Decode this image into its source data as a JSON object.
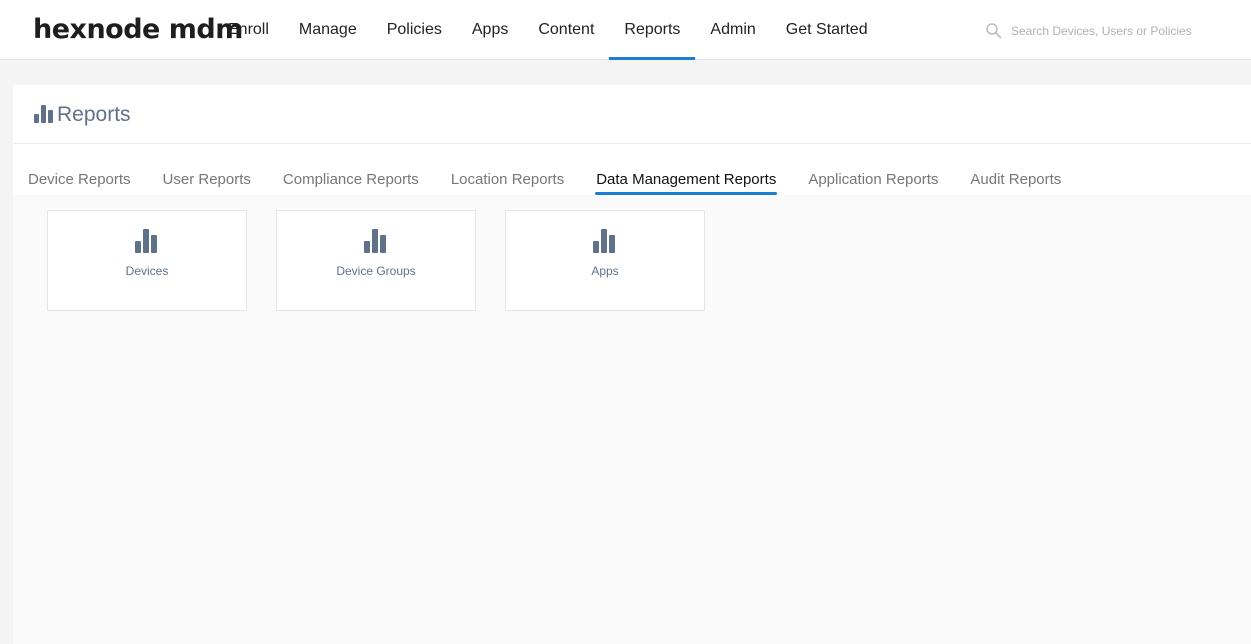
{
  "brand": {
    "logo_text": "hexnode mdm"
  },
  "nav": {
    "items": [
      {
        "label": "Enroll"
      },
      {
        "label": "Manage"
      },
      {
        "label": "Policies"
      },
      {
        "label": "Apps"
      },
      {
        "label": "Content"
      },
      {
        "label": "Reports",
        "active": true
      },
      {
        "label": "Admin"
      },
      {
        "label": "Get Started"
      }
    ]
  },
  "search": {
    "placeholder": "Search Devices, Users or Policies",
    "value": ""
  },
  "page": {
    "title": "Reports",
    "icon": "bar-chart-icon"
  },
  "tabs": [
    {
      "label": "Device Reports"
    },
    {
      "label": "User Reports"
    },
    {
      "label": "Compliance Reports"
    },
    {
      "label": "Location Reports"
    },
    {
      "label": "Data Management Reports",
      "active": true
    },
    {
      "label": "Application Reports"
    },
    {
      "label": "Audit Reports"
    }
  ],
  "cards": [
    {
      "label": "Devices",
      "icon": "bar-chart-icon"
    },
    {
      "label": "Device Groups",
      "icon": "bar-chart-icon"
    },
    {
      "label": "Apps",
      "icon": "bar-chart-icon"
    }
  ],
  "colors": {
    "accent": "#1b7fd6",
    "icon": "#5f7289",
    "title": "#5f7289"
  }
}
